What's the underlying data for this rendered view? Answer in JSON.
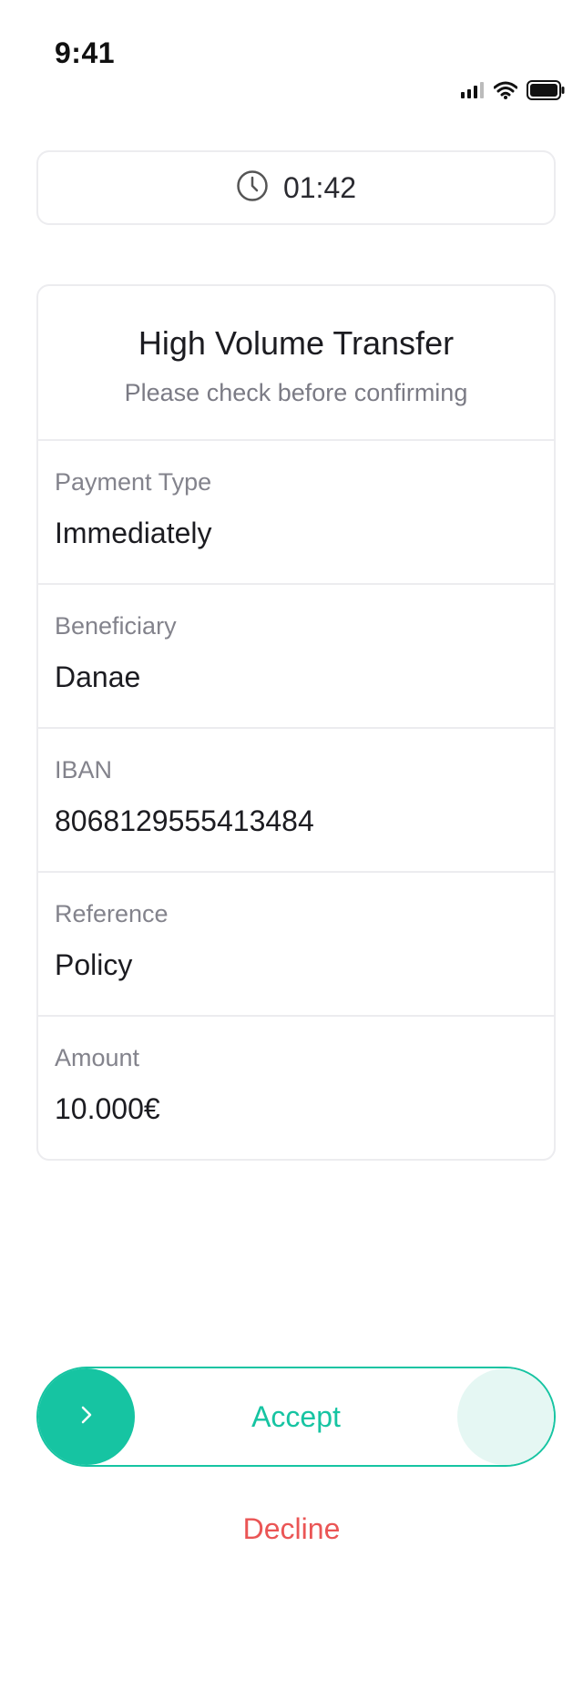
{
  "status_bar": {
    "time": "9:41",
    "icons": [
      "signal-icon",
      "wifi-icon",
      "battery-icon"
    ]
  },
  "timer": {
    "icon": "clock-icon",
    "value": "01:42"
  },
  "card": {
    "title": "High Volume Transfer",
    "subtitle": "Please check before confirming",
    "rows": [
      {
        "label": "Payment Type",
        "value": "Immediately"
      },
      {
        "label": "Beneficiary",
        "value": "Danae"
      },
      {
        "label": "IBAN",
        "value": "8068129555413484"
      },
      {
        "label": "Reference",
        "value": "Policy"
      },
      {
        "label": "Amount",
        "value": "10.000€"
      }
    ]
  },
  "actions": {
    "accept_label": "Accept",
    "decline_label": "Decline"
  },
  "colors": {
    "accent": "#16c4a2",
    "decline": "#ea5555",
    "border": "#ececef"
  }
}
